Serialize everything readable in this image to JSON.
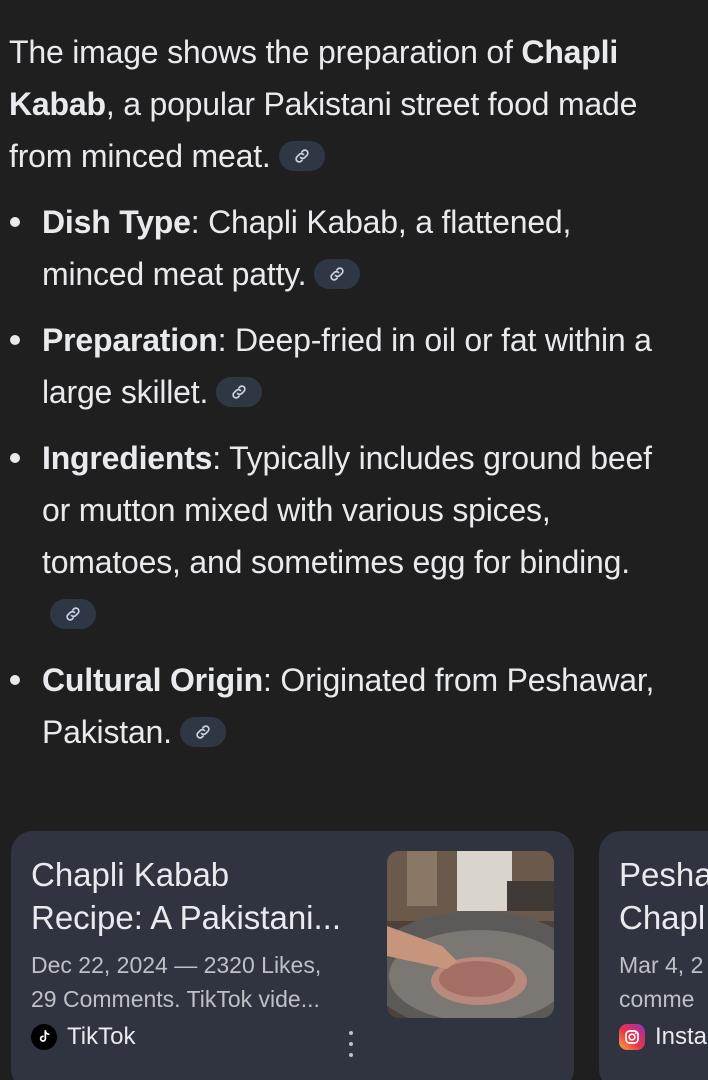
{
  "intro": {
    "lead": "The image shows the preparation of ",
    "dish": "Chapli Kabab",
    "rest": ", a popular Pakistani street food made from minced meat."
  },
  "items": [
    {
      "term": "Dish Type",
      "text": ": Chapli Kabab, a flattened, minced meat patty."
    },
    {
      "term": "Preparation",
      "text": ": Deep-fried in oil or fat within a large skillet."
    },
    {
      "term": "Ingredients",
      "text": ": Typically includes ground beef or mutton mixed with various spices, tomatoes, and sometimes egg for binding."
    },
    {
      "term": "Cultural Origin",
      "text": ": Originated from Peshawar, Pakistan."
    }
  ],
  "cards": [
    {
      "title_line1": "Chapli Kabab",
      "title_line2": "Recipe: A Pakistani...",
      "snippet_line1": "Dec 22, 2024 — 2320 Likes,",
      "snippet_line2": "29 Comments. TikTok vide...",
      "source": "TikTok",
      "source_icon": "tiktok-icon"
    },
    {
      "title_line1": "Pesha",
      "title_line2": "Chapl",
      "snippet_line1": "Mar 4, 2",
      "snippet_line2": "comme",
      "source": "Insta",
      "source_icon": "instagram-icon"
    }
  ],
  "colors": {
    "background": "#1f1f1f",
    "card": "#303440",
    "chip": "#303744",
    "text": "#e8eaed",
    "muted": "#bdc1c6"
  },
  "icons": {
    "citation": "link-icon",
    "menu": "more-vert-icon"
  }
}
